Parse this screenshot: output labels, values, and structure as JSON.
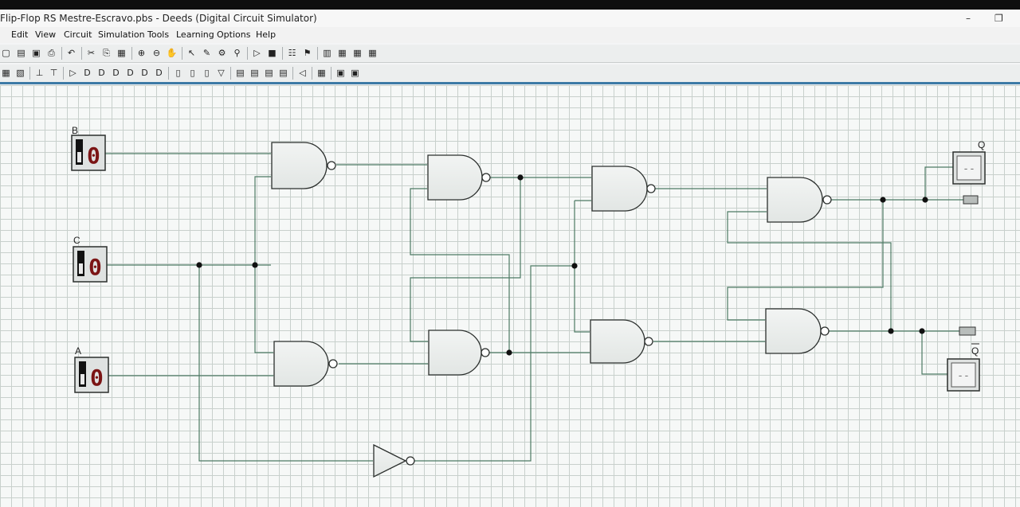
{
  "window": {
    "title": "Flip-Flop RS Mestre-Escravo.pbs - Deeds (Digital Circuit Simulator)",
    "controls": {
      "minimize": "–",
      "restore": "❐"
    }
  },
  "menu": [
    "Edit",
    "View",
    "Circuit",
    "Simulation",
    "Tools",
    "Learning",
    "Options",
    "Help"
  ],
  "toolbar1": [
    {
      "name": "new-icon",
      "glyph": "▢"
    },
    {
      "name": "open-icon",
      "glyph": "▤"
    },
    {
      "name": "save-icon",
      "glyph": "▣"
    },
    {
      "name": "print-icon",
      "glyph": "⎙"
    },
    {
      "name": "undo-icon",
      "glyph": "↶"
    },
    {
      "name": "cut-icon",
      "glyph": "✂"
    },
    {
      "name": "copy-icon",
      "glyph": "⎘"
    },
    {
      "name": "paste-icon",
      "glyph": "▦"
    },
    {
      "name": "zoom-in-icon",
      "glyph": "⊕"
    },
    {
      "name": "zoom-out-icon",
      "glyph": "⊖"
    },
    {
      "name": "pan-hand-icon",
      "glyph": "✋"
    },
    {
      "name": "select-arrow-icon",
      "glyph": "↖"
    },
    {
      "name": "wire-pen-icon",
      "glyph": "✎"
    },
    {
      "name": "component-icon",
      "glyph": "⚙"
    },
    {
      "name": "probe-icon",
      "glyph": "⚲"
    },
    {
      "name": "run-simulation-icon",
      "glyph": "▷"
    },
    {
      "name": "stop-simulation-icon",
      "glyph": "■"
    },
    {
      "name": "timing-diagram-icon",
      "glyph": "☷"
    },
    {
      "name": "test-icon",
      "glyph": "⚑"
    },
    {
      "name": "board-icon",
      "glyph": "▥"
    },
    {
      "name": "chip-1-icon",
      "glyph": "▦"
    },
    {
      "name": "chip-2-icon",
      "glyph": "▦"
    },
    {
      "name": "chip-3-icon",
      "glyph": "▦"
    }
  ],
  "toolbar2": [
    {
      "name": "input-switch-icon",
      "glyph": "▦"
    },
    {
      "name": "clock-icon",
      "glyph": "▧"
    },
    {
      "name": "ground-icon",
      "glyph": "⊥"
    },
    {
      "name": "vcc-icon",
      "glyph": "⊤"
    },
    {
      "name": "buffer-gate-icon",
      "glyph": "▷"
    },
    {
      "name": "and-gate-icon",
      "glyph": "D"
    },
    {
      "name": "nand-gate-icon",
      "glyph": "D"
    },
    {
      "name": "or-gate-icon",
      "glyph": "D"
    },
    {
      "name": "nor-gate-icon",
      "glyph": "D"
    },
    {
      "name": "xor-gate-icon",
      "glyph": "D"
    },
    {
      "name": "xnor-gate-icon",
      "glyph": "D"
    },
    {
      "name": "d-flipflop-icon",
      "glyph": "▯"
    },
    {
      "name": "jk-flipflop-icon",
      "glyph": "▯"
    },
    {
      "name": "t-flipflop-icon",
      "glyph": "▯"
    },
    {
      "name": "mux-icon",
      "glyph": "▽"
    },
    {
      "name": "register-icon",
      "glyph": "▤"
    },
    {
      "name": "counter-icon",
      "glyph": "▤"
    },
    {
      "name": "memory-icon",
      "glyph": "▤"
    },
    {
      "name": "display-icon",
      "glyph": "▤"
    },
    {
      "name": "led-output-icon",
      "glyph": "◁"
    },
    {
      "name": "keyboard-icon",
      "glyph": "▦"
    },
    {
      "name": "hex-display-icon",
      "glyph": "▣"
    },
    {
      "name": "terminal-icon",
      "glyph": "▣"
    }
  ],
  "inputs": [
    {
      "label": "B",
      "value": "0"
    },
    {
      "label": "C",
      "value": "0"
    },
    {
      "label": "A",
      "value": "0"
    }
  ],
  "outputs": [
    {
      "label": "Q",
      "value": "--"
    },
    {
      "label": "Q",
      "value": "--"
    }
  ],
  "colors": {
    "wire": "#4d7a64",
    "gate_fill": "#ebeeec",
    "digit": "#7b1414",
    "accent": "#3d7aa6"
  }
}
